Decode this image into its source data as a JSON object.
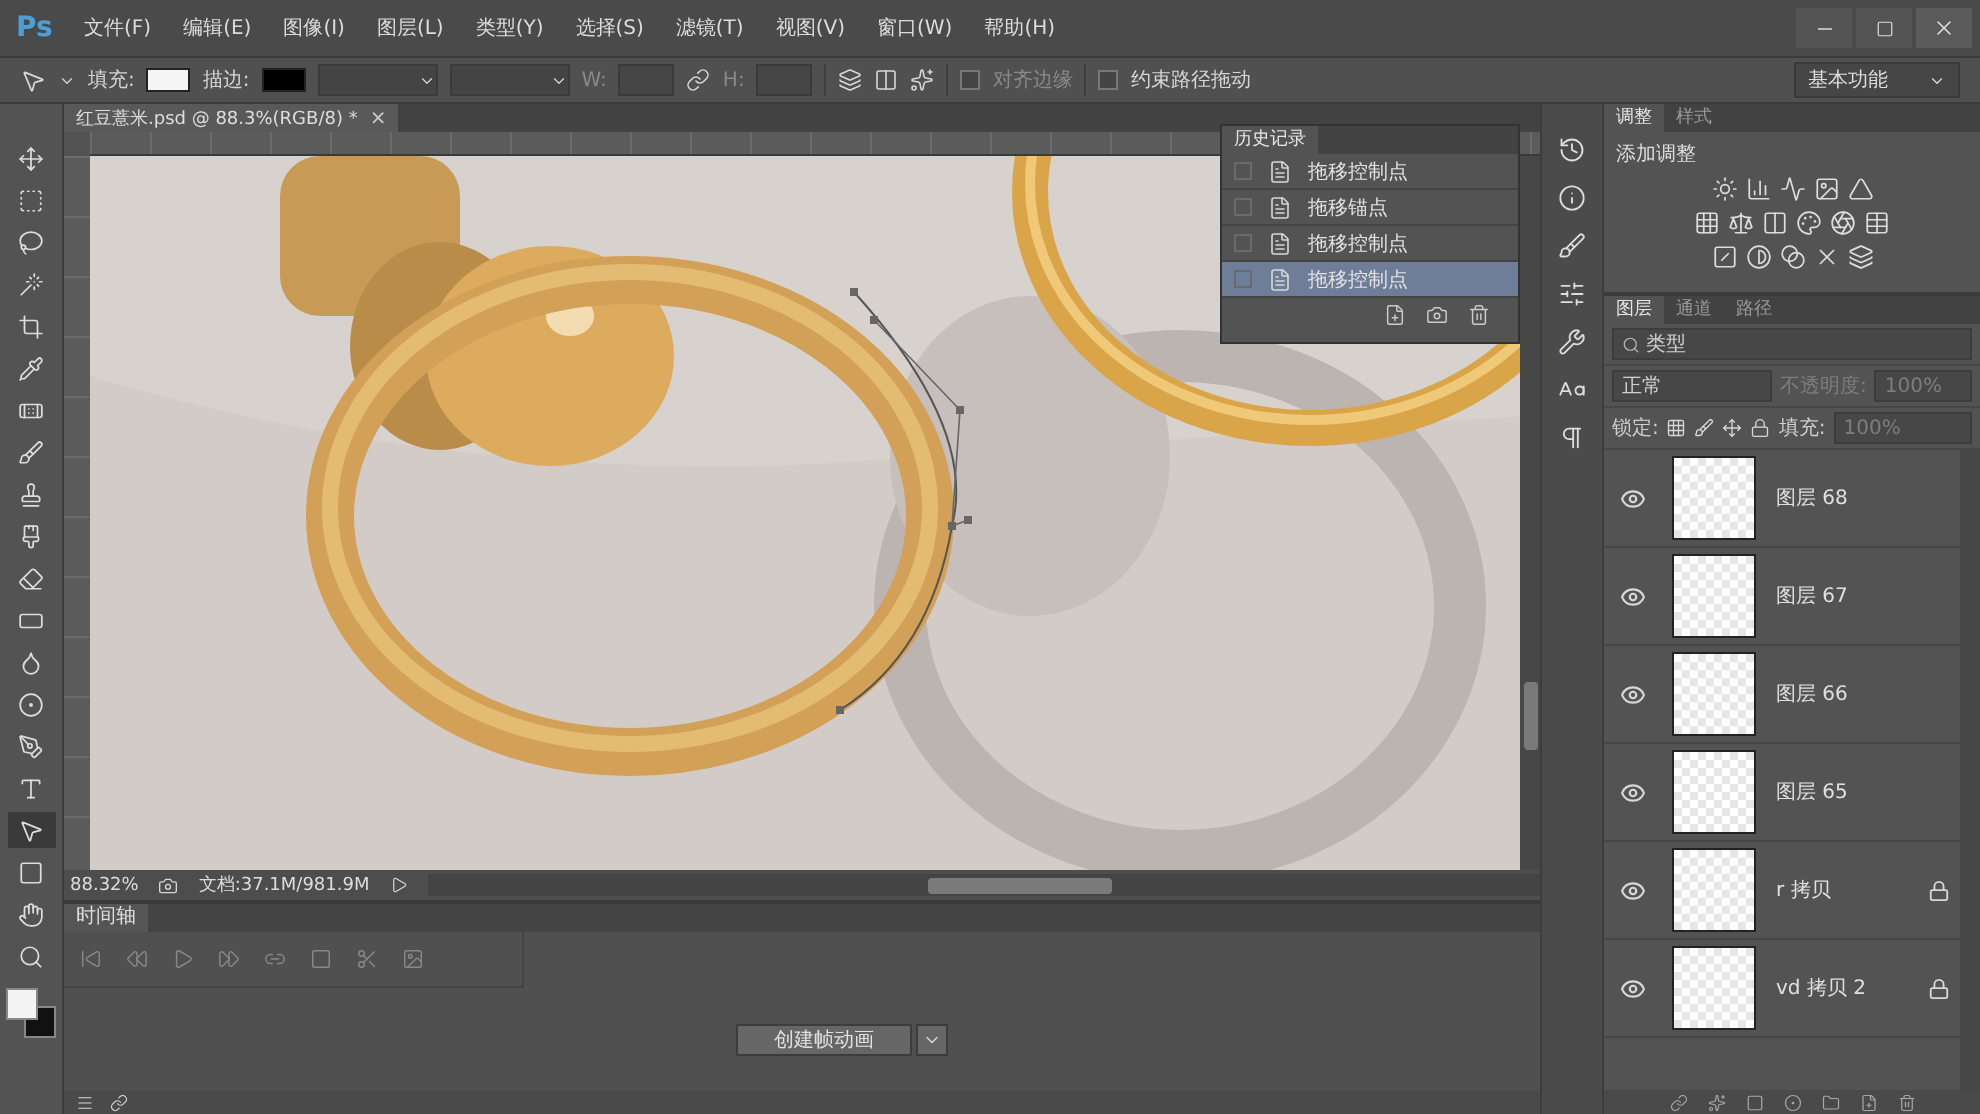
{
  "app": {
    "logo": "Ps"
  },
  "menu": [
    "文件(F)",
    "编辑(E)",
    "图像(I)",
    "图层(L)",
    "类型(Y)",
    "选择(S)",
    "滤镜(T)",
    "视图(V)",
    "窗口(W)",
    "帮助(H)"
  ],
  "options_bar": {
    "fill_label": "填充:",
    "stroke_label": "描边:",
    "w_label": "W:",
    "h_label": "H:",
    "align_edges": {
      "label": "对齐边缘",
      "checked": false,
      "disabled": true
    },
    "constrain_path": {
      "label": "约束路径拖动",
      "checked": false,
      "disabled": false
    },
    "workspace": "基本功能"
  },
  "tools": [
    {
      "kind": "move",
      "selected": false
    },
    {
      "kind": "marquee",
      "selected": false
    },
    {
      "kind": "lasso",
      "selected": false
    },
    {
      "kind": "wand",
      "selected": false
    },
    {
      "kind": "crop",
      "selected": false
    },
    {
      "kind": "eyedropper",
      "selected": false
    },
    {
      "kind": "healing",
      "selected": false
    },
    {
      "kind": "brush",
      "selected": false
    },
    {
      "kind": "stamp",
      "selected": false
    },
    {
      "kind": "history_brush",
      "selected": false
    },
    {
      "kind": "eraser",
      "selected": false
    },
    {
      "kind": "gradient",
      "selected": false
    },
    {
      "kind": "blur",
      "selected": false
    },
    {
      "kind": "dodge",
      "selected": false
    },
    {
      "kind": "pen",
      "selected": false
    },
    {
      "kind": "type",
      "selected": false
    },
    {
      "kind": "path_select",
      "selected": true
    },
    {
      "kind": "shape",
      "selected": false
    },
    {
      "kind": "hand",
      "selected": false
    },
    {
      "kind": "zoom",
      "selected": false
    }
  ],
  "document_tab": {
    "title": "红豆薏米.psd @ 88.3%(RGB/8) *",
    "close": "×"
  },
  "history": {
    "title": "历史记录",
    "items": [
      {
        "label": "拖移控制点",
        "selected": false
      },
      {
        "label": "拖移锚点",
        "selected": false
      },
      {
        "label": "拖移控制点",
        "selected": false
      },
      {
        "label": "拖移控制点",
        "selected": true
      }
    ]
  },
  "adjustments": {
    "tabs": [
      {
        "label": "调整",
        "selected": true
      },
      {
        "label": "样式",
        "selected": false
      }
    ],
    "title": "添加调整"
  },
  "layers": {
    "tabs": [
      {
        "label": "图层",
        "selected": true
      },
      {
        "label": "通道",
        "selected": false
      },
      {
        "label": "路径",
        "selected": false
      }
    ],
    "filter": "类型",
    "blend_mode": "正常",
    "opacity_label": "不透明度:",
    "opacity": "100%",
    "lock_label": "锁定:",
    "fill_label": "填充:",
    "fill": "100%",
    "items": [
      {
        "name": "图层 68",
        "visible": true,
        "locked": false
      },
      {
        "name": "图层 67",
        "visible": true,
        "locked": false
      },
      {
        "name": "图层 66",
        "visible": true,
        "locked": false
      },
      {
        "name": "图层 65",
        "visible": true,
        "locked": false
      },
      {
        "name": "r 拷贝",
        "visible": true,
        "locked": true
      },
      {
        "name": "vd 拷贝 2",
        "visible": true,
        "locked": true
      }
    ]
  },
  "status_bar": {
    "zoom": "88.32%",
    "doc_info": "文档:37.1M/981.9M"
  },
  "timeline": {
    "title": "时间轴",
    "create_button": "创建帧动画"
  }
}
